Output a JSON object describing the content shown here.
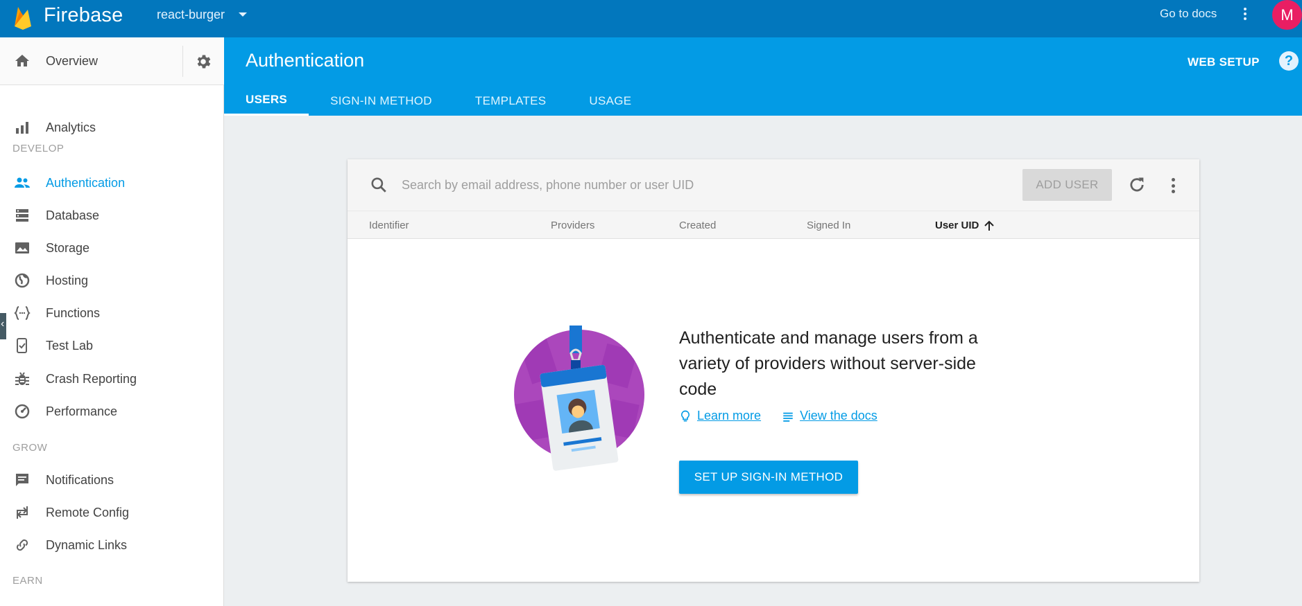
{
  "topbar": {
    "brand": "Firebase",
    "project": "react-burger",
    "docs_link": "Go to docs",
    "avatar_initial": "M"
  },
  "sidebar": {
    "overview": "Overview",
    "items": [
      {
        "label": "Analytics",
        "icon": "analytics-icon"
      },
      {
        "label": "Authentication",
        "icon": "people-icon",
        "active": true
      },
      {
        "label": "Database",
        "icon": "database-icon"
      },
      {
        "label": "Storage",
        "icon": "storage-icon"
      },
      {
        "label": "Hosting",
        "icon": "globe-icon"
      },
      {
        "label": "Functions",
        "icon": "functions-icon"
      },
      {
        "label": "Test Lab",
        "icon": "test-lab-icon"
      },
      {
        "label": "Crash Reporting",
        "icon": "bug-icon"
      },
      {
        "label": "Performance",
        "icon": "speedometer-icon"
      },
      {
        "label": "Notifications",
        "icon": "chat-icon"
      },
      {
        "label": "Remote Config",
        "icon": "remote-config-icon"
      },
      {
        "label": "Dynamic Links",
        "icon": "link-icon"
      }
    ],
    "sections": {
      "develop": "DEVELOP",
      "grow": "GROW",
      "earn": "EARN"
    }
  },
  "header": {
    "title": "Authentication",
    "web_setup": "WEB SETUP",
    "help": "?",
    "tabs": [
      "USERS",
      "SIGN-IN METHOD",
      "TEMPLATES",
      "USAGE"
    ]
  },
  "users": {
    "search_placeholder": "Search by email address, phone number or user UID",
    "add_user": "ADD USER",
    "columns": [
      "Identifier",
      "Providers",
      "Created",
      "Signed In",
      "User UID"
    ],
    "empty_message": "Authenticate and manage users from a variety of providers without server-side code",
    "learn_more": "Learn more",
    "view_docs": "View the docs",
    "cta": "SET UP SIGN-IN METHOD"
  },
  "colors": {
    "topbar": "#0277bd",
    "header": "#039be5",
    "accent": "#039be5",
    "avatar": "#e91e63",
    "illustration": "#ab47bc"
  }
}
